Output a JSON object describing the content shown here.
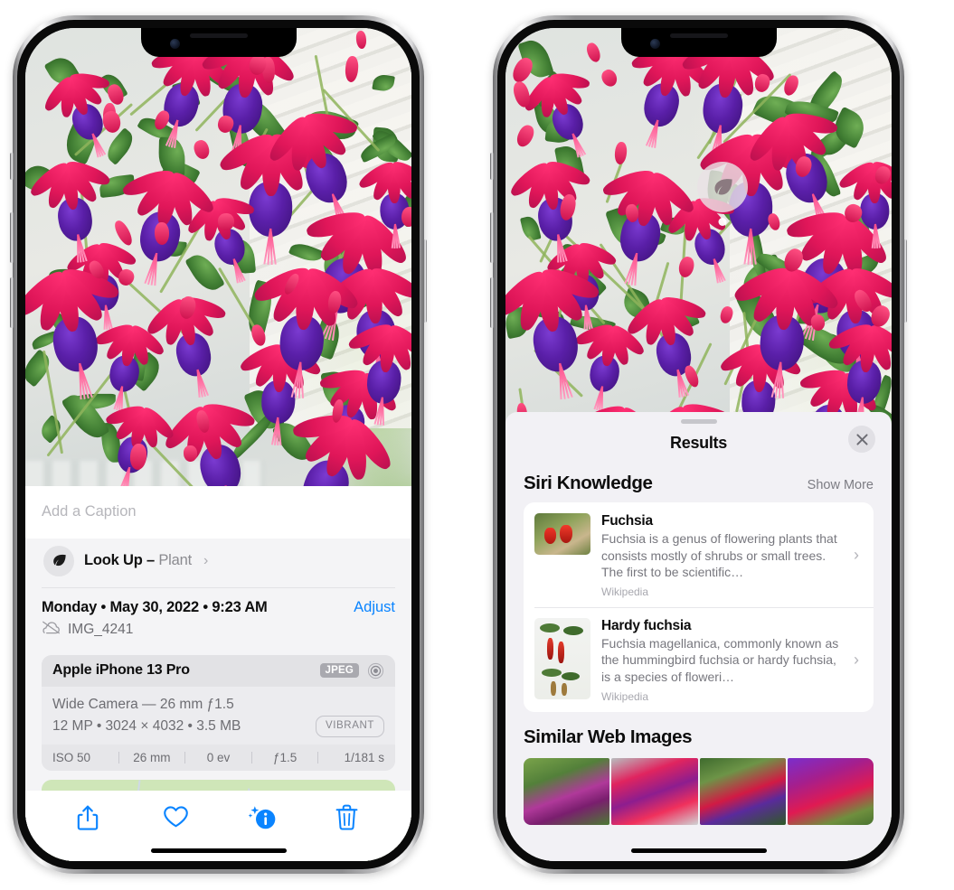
{
  "left_phone": {
    "name": "photos-info-screen",
    "caption_placeholder": "Add a Caption",
    "lookup": {
      "label": "Look Up –",
      "subject": "Plant",
      "icon": "leaf-icon",
      "chevron": "›"
    },
    "date": "Monday • May 30, 2022 • 9:23 AM",
    "adjust_label": "Adjust",
    "filename": "IMG_4241",
    "cloud_icon": "cloud-slash-icon",
    "exif": {
      "device": "Apple iPhone 13 Pro",
      "format_badge": "JPEG",
      "aperture_icon": "aperture-icon",
      "lens_line": "Wide Camera — 26 mm ƒ1.5",
      "spec_line": "12 MP • 3024 × 4032 • 3.5 MB",
      "style_badge": "VIBRANT",
      "stats": [
        "ISO 50",
        "26 mm",
        "0 ev",
        "ƒ1.5",
        "1/181 s"
      ]
    },
    "toolbar": [
      {
        "name": "share-button",
        "icon": "share-icon"
      },
      {
        "name": "favorite-button",
        "icon": "heart-icon"
      },
      {
        "name": "info-button",
        "icon": "info-sparkle-icon"
      },
      {
        "name": "delete-button",
        "icon": "trash-icon"
      }
    ],
    "accent_color": "#0a84ff"
  },
  "right_phone": {
    "name": "visual-lookup-results-screen",
    "photo_badge_icon": "leaf-icon",
    "sheet": {
      "title": "Results",
      "close_icon": "close-icon",
      "sections": [
        {
          "title": "Siri Knowledge",
          "action_label": "Show More",
          "cards": [
            {
              "title": "Fuchsia",
              "description": "Fuchsia is a genus of flowering plants that consists mostly of shrubs or small trees. The first to be scientific…",
              "source": "Wikipedia",
              "chevron": "›"
            },
            {
              "title": "Hardy fuchsia",
              "description": "Fuchsia magellanica, commonly known as the hummingbird fuchsia or hardy fuchsia, is a species of floweri…",
              "source": "Wikipedia",
              "chevron": "›"
            }
          ]
        },
        {
          "title": "Similar Web Images",
          "images": [
            {
              "name": "web-image-1"
            },
            {
              "name": "web-image-2"
            },
            {
              "name": "web-image-3"
            },
            {
              "name": "web-image-4"
            }
          ]
        }
      ]
    }
  }
}
